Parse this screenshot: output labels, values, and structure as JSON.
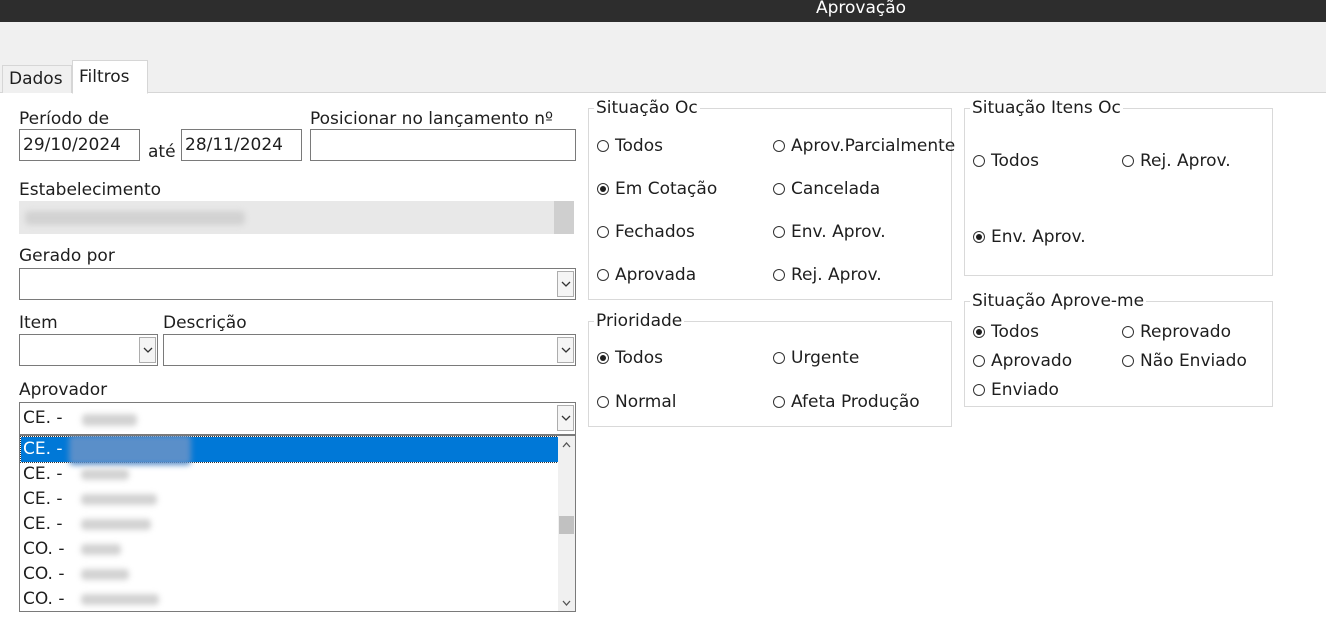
{
  "window": {
    "title": "Aprovação"
  },
  "tabs": [
    {
      "label": "Dados"
    },
    {
      "label": "Filtros"
    }
  ],
  "periodo": {
    "label": "Período de",
    "from": "29/10/2024",
    "separator": "até",
    "to": "28/11/2024"
  },
  "posicionar": {
    "label": "Posicionar no lançamento nº",
    "value": ""
  },
  "estabelecimento": {
    "label": "Estabelecimento"
  },
  "gerado_por": {
    "label": "Gerado por",
    "value": ""
  },
  "item": {
    "label": "Item",
    "value": ""
  },
  "descricao": {
    "label": "Descrição",
    "value": ""
  },
  "aprovador": {
    "label": "Aprovador",
    "selected_prefix": "CE. -",
    "options": [
      {
        "prefix": "CE. -",
        "selected": true
      },
      {
        "prefix": "CE. -",
        "selected": false
      },
      {
        "prefix": "CE. -",
        "selected": false
      },
      {
        "prefix": "CE. -",
        "selected": false
      },
      {
        "prefix": "CO. -",
        "selected": false
      },
      {
        "prefix": "CO. -",
        "selected": false
      },
      {
        "prefix": "CO. -",
        "selected": false
      }
    ]
  },
  "situacao_oc": {
    "title": "Situação Oc",
    "options": [
      {
        "label": "Todos",
        "checked": false
      },
      {
        "label": "Aprov.Parcialmente",
        "checked": false
      },
      {
        "label": "Em Cotação",
        "checked": true
      },
      {
        "label": "Cancelada",
        "checked": false
      },
      {
        "label": "Fechados",
        "checked": false
      },
      {
        "label": "Env. Aprov.",
        "checked": false
      },
      {
        "label": "Aprovada",
        "checked": false
      },
      {
        "label": "Rej. Aprov.",
        "checked": false
      }
    ]
  },
  "prioridade": {
    "title": "Prioridade",
    "options": [
      {
        "label": "Todos",
        "checked": true
      },
      {
        "label": "Urgente",
        "checked": false
      },
      {
        "label": "Normal",
        "checked": false
      },
      {
        "label": "Afeta Produção",
        "checked": false
      }
    ]
  },
  "situacao_itens_oc": {
    "title": "Situação Itens Oc",
    "options": [
      {
        "label": "Todos",
        "checked": false
      },
      {
        "label": "Rej. Aprov.",
        "checked": false
      },
      {
        "label": "Env. Aprov.",
        "checked": true
      }
    ]
  },
  "situacao_aprove_me": {
    "title": "Situação Aprove-me",
    "options": [
      {
        "label": "Todos",
        "checked": true
      },
      {
        "label": "Reprovado",
        "checked": false
      },
      {
        "label": "Aprovado",
        "checked": false
      },
      {
        "label": "Não Enviado",
        "checked": false
      },
      {
        "label": "Enviado",
        "checked": false
      }
    ]
  },
  "colors": {
    "titlebar": "#2d2d2d",
    "selection": "#0078d7",
    "panel": "#f0f0f0"
  },
  "icons": {
    "dropdown": "chevron-down-icon",
    "scroll_up": "chevron-up-icon",
    "scroll_down": "chevron-down-icon"
  }
}
